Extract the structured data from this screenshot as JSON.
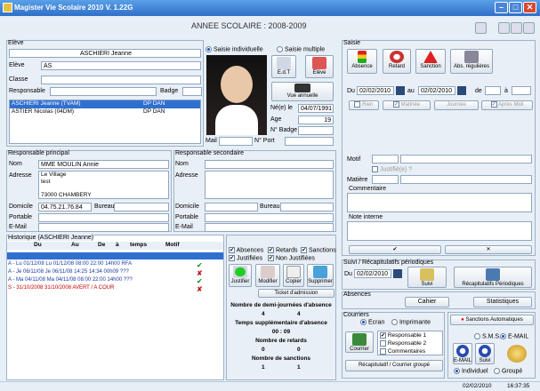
{
  "app": {
    "title": "Magister Vie Scolaire 2010 V. 1.22G"
  },
  "header": {
    "year": "ANNEE SCOLAIRE : 2008-2009"
  },
  "eleve": {
    "group": "Elève",
    "name_display": "ASCHIERI Jeanne",
    "label_eleve": "Elève",
    "eleve_value": "AS",
    "label_classe": "Classe",
    "label_responsable": "Responsable",
    "label_badge": "Badge",
    "list": [
      {
        "name": "ASCHIERI Jeanne (TVAM)",
        "code": "DP DAN"
      },
      {
        "name": "ASTIER Nicolas (04DM)",
        "code": "DP DAN"
      }
    ],
    "saisie_individuelle": "Saisie individuelle",
    "saisie_multiple": "Saisie multiple",
    "edt": "E.d.T",
    "eleve_btn": "Elève",
    "vue_annuelle": "Vue annuelle",
    "ne_label": "Né(e) le",
    "ne_value": "04/07/1991",
    "age_label": "Age",
    "age_value": "19",
    "nbadge_label": "N° Badge",
    "mail_label": "Mail",
    "nport_label": "N° Port"
  },
  "resp_principal": {
    "group": "Responsable principal",
    "nom_label": "Nom",
    "nom": "MME MOULIN Annie",
    "adresse_label": "Adresse",
    "adresse": [
      "Le Village",
      "test",
      "",
      "73000 CHAMBERY"
    ],
    "domicile_label": "Domicile",
    "domicile": "04.75.21.76.84",
    "bureau_label": "Bureau",
    "portable_label": "Portable",
    "email_label": "E-Mail"
  },
  "resp_secondaire": {
    "group": "Responsable secondaire",
    "nom_label": "Nom",
    "adresse_label": "Adresse",
    "domicile_label": "Domicile",
    "bureau_label": "Bureau",
    "portable_label": "Portable",
    "email_label": "E-Mail"
  },
  "historique": {
    "group": "Historique (ASCHIERI Jeanne)",
    "cols": [
      "Du",
      "Au",
      "De",
      "à",
      "temps",
      "Motif"
    ],
    "rows": [
      {
        "text": "A - Lu 01/12/08  Lu 01/12/08  08:00 22:00 14h00 RFA",
        "mark": "✔",
        "cls": "blue"
      },
      {
        "text": "A - Je 06/11/08  Je 06/11/08  14:25 14:34 00h09 ???",
        "mark": "✘",
        "cls": "blue"
      },
      {
        "text": "A - Ma 04/11/08  Ma 04/11/08  08:00 22:00 14h00 ???",
        "mark": "✔",
        "cls": "blue"
      },
      {
        "text": "S - 31/10/2008   31/10/2008                 AVERT / A COUR",
        "mark": "✘",
        "cls": "red"
      }
    ]
  },
  "filters": {
    "absences": "Absences",
    "retards": "Retards",
    "sanctions": "Sanctions",
    "justifiees": "Justifiées",
    "non_justifiees": "Non Justifiées"
  },
  "hist_buttons": {
    "justifier": "Justifier",
    "modifier": "Modifier",
    "copier": "Copier",
    "supprimer": "Supprimer",
    "ticket": "Ticket d'admission"
  },
  "stats": {
    "demi_label": "Nombre de demi-journées d'absence",
    "demi": [
      "4",
      "4"
    ],
    "temps_label": "Temps supplémentaire d'absence",
    "temps": "00 : 09",
    "retards_label": "Nombre de retards",
    "retards": [
      "0",
      "0"
    ],
    "sanctions_label": "Nombre de sanctions",
    "sanctions": [
      "1",
      "1"
    ]
  },
  "saisie": {
    "group": "Saisie",
    "buttons": [
      "Absence",
      "Retard",
      "Sanction",
      "Abs. régulières"
    ],
    "du_label": "Du",
    "du": "02/02/2010",
    "au_label": "au",
    "au": "02/02/2010",
    "de_label": "de",
    "a_label": "à",
    "periods": [
      "Rien",
      "Matinée",
      "Journée",
      "Après Midi"
    ],
    "motif_label": "Motif",
    "justifie_label": "Justifié(e) ?",
    "matiere_label": "Matière",
    "commentaire_label": "Commentaire",
    "note_label": "Note interne"
  },
  "suivi": {
    "group": "Suivi / Récapitulatifs périodiques",
    "du_label": "Du",
    "du": "02/02/2010",
    "suivi_btn": "Suivi",
    "recap_btn": "Récapitulatifs Périodiques"
  },
  "absences": {
    "group": "Absences",
    "cahier": "Cahier",
    "statistiques": "Statistiques"
  },
  "courriers": {
    "group": "Courriers",
    "ecran": "Ecran",
    "imprimante": "Imprimante",
    "resp1": "Responsable 1",
    "resp2": "Responsable 2",
    "commentaires": "Commentaires",
    "courrier_btn": "Courrier",
    "recap_btn": "Récapitulatif / Courrier groupé"
  },
  "sanctions_auto": {
    "btn": "Sanctions Automatiques",
    "sms": "S.M.S.",
    "email": "E-MAIL",
    "email_btn": "E-MAIL",
    "suivi_btn": "Suivi",
    "individuel": "Individuel",
    "groupe": "Groupé"
  },
  "status": {
    "date": "02/02/2010",
    "time": "16:37:35"
  },
  "colors": {
    "titlebar": "#2f6fc8",
    "selection": "#2f6fd0",
    "red": "#c00000",
    "green": "#0a8a0a"
  }
}
